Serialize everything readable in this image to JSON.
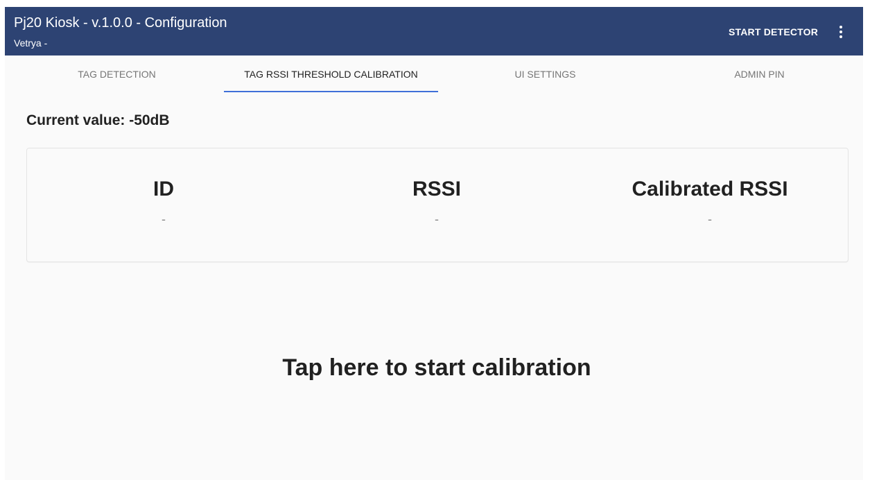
{
  "appbar": {
    "title": "Pj20 Kiosk - v.1.0.0 - Configuration",
    "subtitle": "Vetrya -",
    "start_detector_label": "START DETECTOR",
    "more_icon": "more-vert-icon",
    "background_color": "#2d4373"
  },
  "tabs": [
    {
      "label": "TAG DETECTION",
      "active": false
    },
    {
      "label": "TAG RSSI THRESHOLD CALIBRATION",
      "active": true
    },
    {
      "label": "UI SETTINGS",
      "active": false
    },
    {
      "label": "ADMIN PIN",
      "active": false
    }
  ],
  "tab_indicator_color": "#3f6fd8",
  "calibration": {
    "current_value_text": "Current value: -50dB",
    "columns": [
      {
        "header": "ID",
        "value": "-"
      },
      {
        "header": "RSSI",
        "value": "-"
      },
      {
        "header": "Calibrated RSSI",
        "value": "-"
      }
    ],
    "tap_text": "Tap here to start calibration"
  }
}
